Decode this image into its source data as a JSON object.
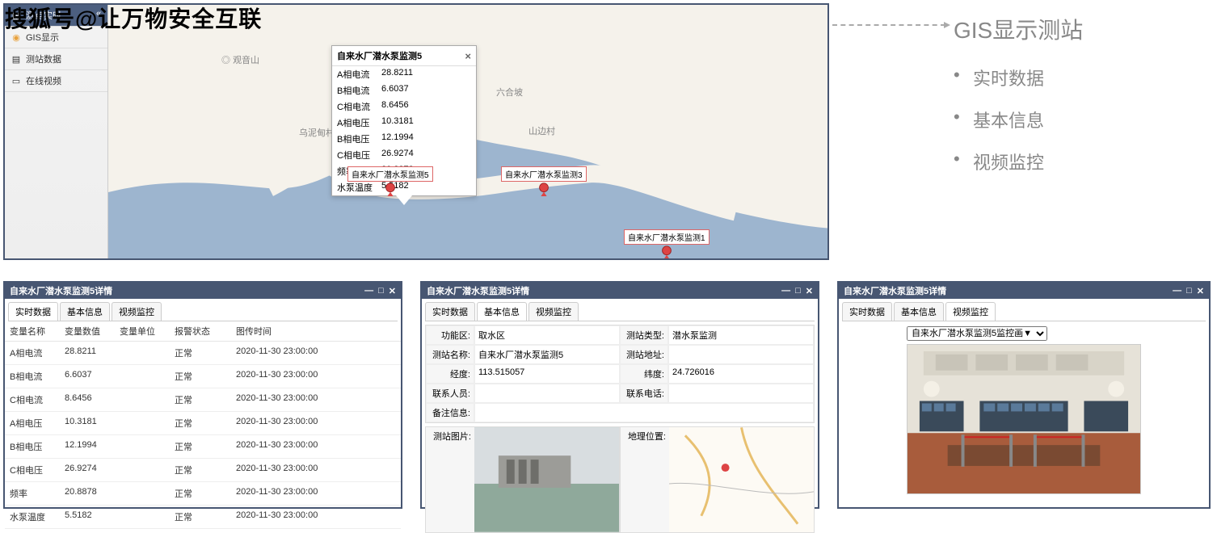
{
  "watermark": "搜狐号@让万物安全互联",
  "sidebar": {
    "items": [
      {
        "label": "测点实时"
      },
      {
        "label": "GIS显示"
      },
      {
        "label": "测站数据"
      },
      {
        "label": "在线视频"
      }
    ]
  },
  "map": {
    "places": {
      "guanyinshan": "观音山",
      "liuhepo": "六合坡",
      "wunidian": "乌泥甸村",
      "shanbian": "山边村"
    },
    "popup": {
      "title": "自来水厂潜水泵监测5",
      "rows": [
        {
          "k": "A相电流",
          "v": "28.8211"
        },
        {
          "k": "B相电流",
          "v": "6.6037"
        },
        {
          "k": "C相电流",
          "v": "8.6456"
        },
        {
          "k": "A相电压",
          "v": "10.3181"
        },
        {
          "k": "B相电压",
          "v": "12.1994"
        },
        {
          "k": "C相电压",
          "v": "26.9274"
        },
        {
          "k": "频率",
          "v": "20.8878"
        },
        {
          "k": "水泵温度",
          "v": "5.5182"
        }
      ]
    },
    "markers": {
      "m5": "自来水厂潜水泵监测5",
      "m3": "自来水厂潜水泵监测3",
      "m1": "自来水厂潜水泵监测1"
    }
  },
  "caption": {
    "title": "GIS显示测站",
    "items": [
      "实时数据",
      "基本信息",
      "视频监控"
    ]
  },
  "detail_title": "自来水厂潜水泵监测5详情",
  "tabs": {
    "realtime": "实时数据",
    "basic": "基本信息",
    "video": "视频监控"
  },
  "realtime": {
    "headers": {
      "name": "变量名称",
      "val": "变量数值",
      "unit": "变量单位",
      "alarm": "报警状态",
      "time": "图传时间"
    },
    "status": "正常",
    "timestamp": "2020-11-30 23:00:00",
    "rows": [
      {
        "name": "A相电流",
        "val": "28.8211"
      },
      {
        "name": "B相电流",
        "val": "6.6037"
      },
      {
        "name": "C相电流",
        "val": "8.6456"
      },
      {
        "name": "A相电压",
        "val": "10.3181"
      },
      {
        "name": "B相电压",
        "val": "12.1994"
      },
      {
        "name": "C相电压",
        "val": "26.9274"
      },
      {
        "name": "频率",
        "val": "20.8878"
      },
      {
        "name": "水泵温度",
        "val": "5.5182"
      }
    ]
  },
  "basic": {
    "labels": {
      "area": "功能区:",
      "type": "测站类型:",
      "name": "测站名称:",
      "addr": "测站地址:",
      "lon": "经度:",
      "lat": "纬度:",
      "contact": "联系人员:",
      "phone": "联系电话:",
      "note": "备注信息:",
      "img": "测站图片:",
      "loc": "地理位置:"
    },
    "values": {
      "area": "取水区",
      "type": "潜水泵监测",
      "name": "自来水厂潜水泵监测5",
      "addr": "",
      "lon": "113.515057",
      "lat": "24.726016",
      "contact": "",
      "phone": "",
      "note": ""
    }
  },
  "video": {
    "select": "自来水厂潜水泵监测5监控画▼"
  }
}
